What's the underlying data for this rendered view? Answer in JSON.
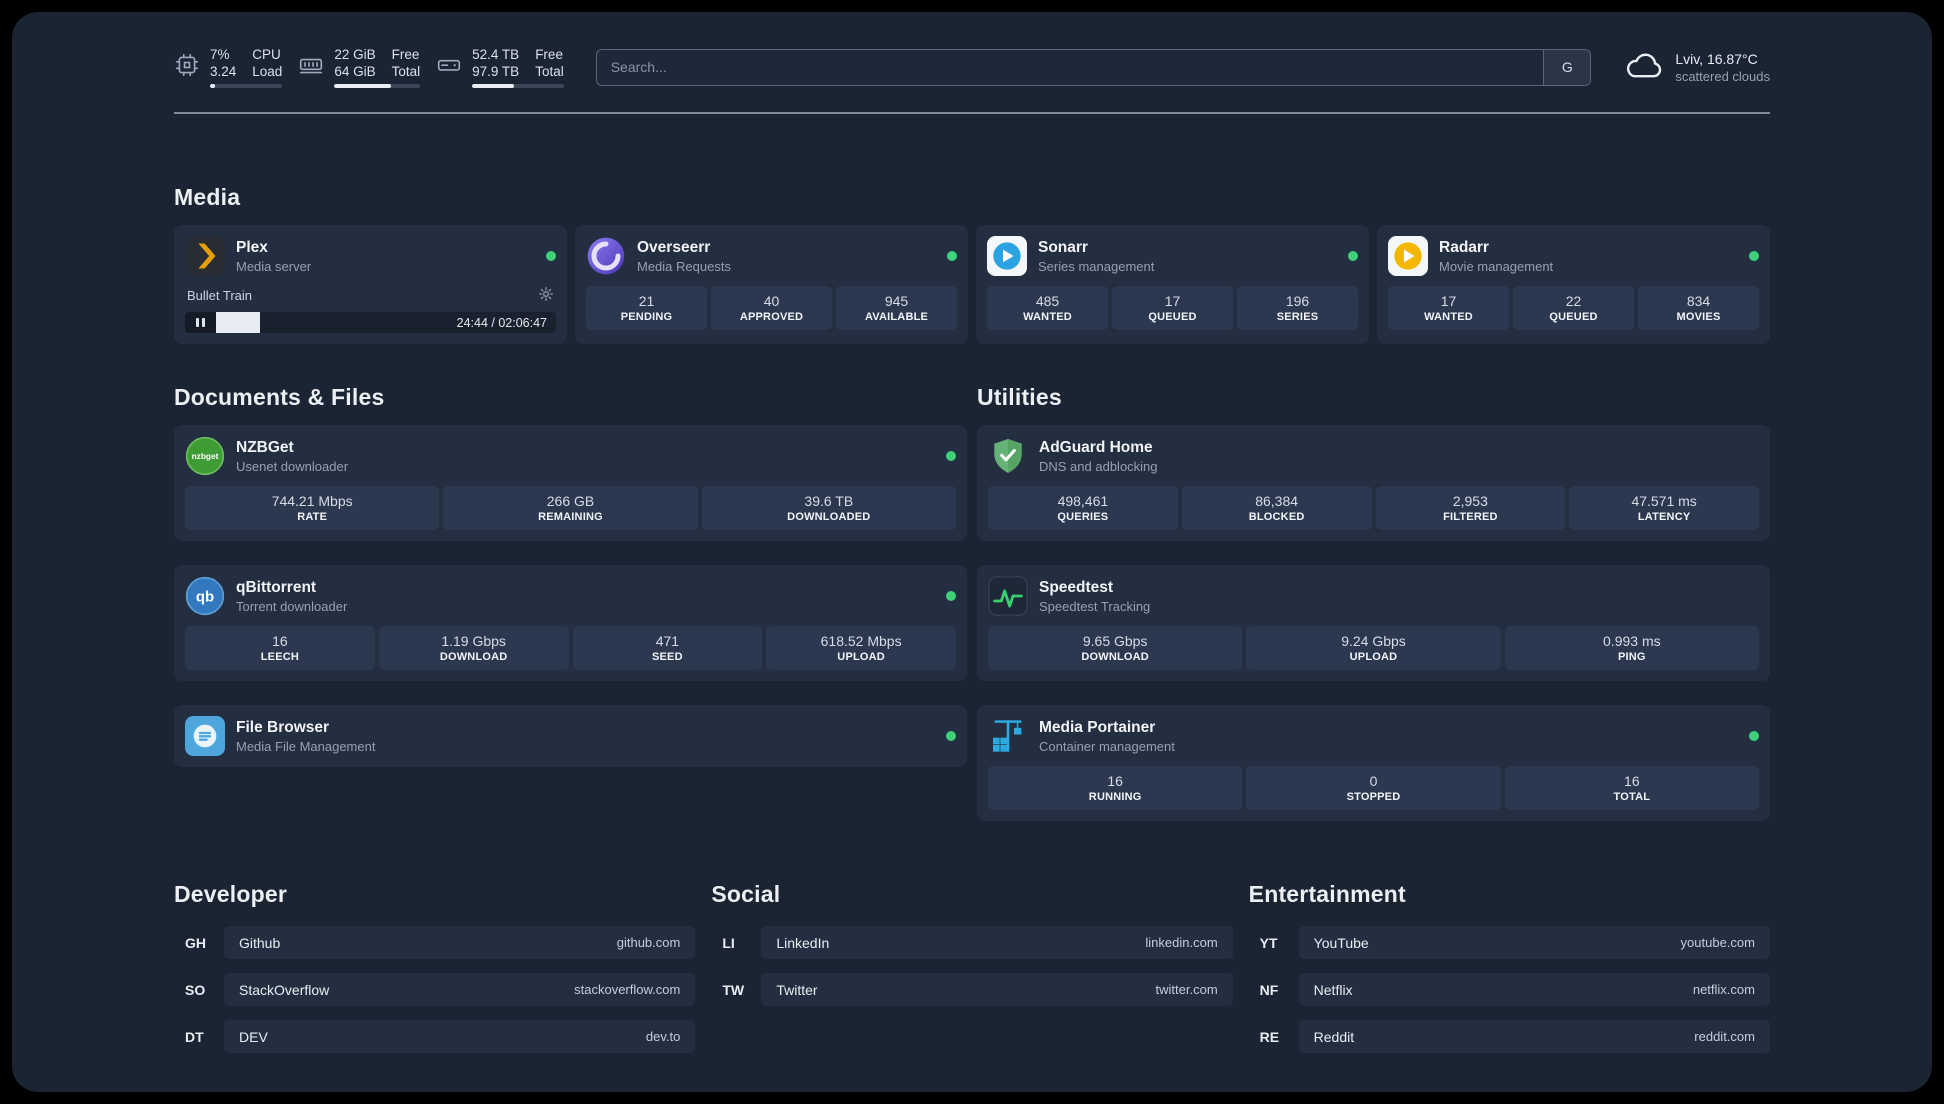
{
  "topbar": {
    "cpu": {
      "icon": "cpu-chip-icon",
      "value_top": "7%",
      "value_bottom": "3.24",
      "label_top": "CPU",
      "label_bottom": "Load",
      "percent": 7
    },
    "ram": {
      "icon": "memory-icon",
      "value_top": "22 GiB",
      "value_bottom": "64 GiB",
      "label_top": "Free",
      "label_bottom": "Total",
      "percent": 66
    },
    "disk": {
      "icon": "hard-drive-icon",
      "value_top": "52.4 TB",
      "value_bottom": "97.9 TB",
      "label_top": "Free",
      "label_bottom": "Total",
      "percent": 46
    },
    "search": {
      "placeholder": "Search...",
      "button_label": "G"
    },
    "weather": {
      "icon": "cloud-icon",
      "location": "Lviv, 16.87°C",
      "condition": "scattered clouds"
    }
  },
  "sections": {
    "media": "Media",
    "documents": "Documents & Files",
    "utilities": "Utilities",
    "developer": "Developer",
    "social": "Social",
    "entertainment": "Entertainment"
  },
  "media": {
    "cards": [
      {
        "name": "Plex",
        "subtitle": "Media server",
        "status": "online",
        "player": {
          "title": "Bullet Train",
          "time": "24:44 / 02:06:47",
          "progress_percent": 13
        }
      },
      {
        "name": "Overseerr",
        "subtitle": "Media Requests",
        "status": "online",
        "stats": [
          {
            "value": "21",
            "label": "PENDING"
          },
          {
            "value": "40",
            "label": "APPROVED"
          },
          {
            "value": "945",
            "label": "AVAILABLE"
          }
        ]
      },
      {
        "name": "Sonarr",
        "subtitle": "Series management",
        "status": "online",
        "stats": [
          {
            "value": "485",
            "label": "WANTED"
          },
          {
            "value": "17",
            "label": "QUEUED"
          },
          {
            "value": "196",
            "label": "SERIES"
          }
        ]
      },
      {
        "name": "Radarr",
        "subtitle": "Movie management",
        "status": "online",
        "stats": [
          {
            "value": "17",
            "label": "WANTED"
          },
          {
            "value": "22",
            "label": "QUEUED"
          },
          {
            "value": "834",
            "label": "MOVIES"
          }
        ]
      }
    ]
  },
  "documents": {
    "cards": [
      {
        "name": "NZBGet",
        "subtitle": "Usenet downloader",
        "status": "online",
        "stats": [
          {
            "value": "744.21 Mbps",
            "label": "RATE"
          },
          {
            "value": "266 GB",
            "label": "REMAINING"
          },
          {
            "value": "39.6 TB",
            "label": "DOWNLOADED"
          }
        ]
      },
      {
        "name": "qBittorrent",
        "subtitle": "Torrent downloader",
        "status": "online",
        "stats": [
          {
            "value": "16",
            "label": "LEECH"
          },
          {
            "value": "1.19 Gbps",
            "label": "DOWNLOAD"
          },
          {
            "value": "471",
            "label": "SEED"
          },
          {
            "value": "618.52 Mbps",
            "label": "UPLOAD"
          }
        ]
      },
      {
        "name": "File Browser",
        "subtitle": "Media File Management",
        "status": "online"
      }
    ]
  },
  "utilities": {
    "cards": [
      {
        "name": "AdGuard Home",
        "subtitle": "DNS and adblocking",
        "stats": [
          {
            "value": "498,461",
            "label": "QUERIES"
          },
          {
            "value": "86,384",
            "label": "BLOCKED"
          },
          {
            "value": "2,953",
            "label": "FILTERED"
          },
          {
            "value": "47.571 ms",
            "label": "LATENCY"
          }
        ]
      },
      {
        "name": "Speedtest",
        "subtitle": "Speedtest Tracking",
        "stats": [
          {
            "value": "9.65 Gbps",
            "label": "DOWNLOAD"
          },
          {
            "value": "9.24 Gbps",
            "label": "UPLOAD"
          },
          {
            "value": "0.993 ms",
            "label": "PING"
          }
        ]
      },
      {
        "name": "Media Portainer",
        "subtitle": "Container management",
        "status": "online",
        "stats": [
          {
            "value": "16",
            "label": "RUNNING"
          },
          {
            "value": "0",
            "label": "STOPPED"
          },
          {
            "value": "16",
            "label": "TOTAL"
          }
        ]
      }
    ]
  },
  "bookmarks": {
    "developer": [
      {
        "abbr": "GH",
        "name": "Github",
        "url": "github.com"
      },
      {
        "abbr": "SO",
        "name": "StackOverflow",
        "url": "stackoverflow.com"
      },
      {
        "abbr": "DT",
        "name": "DEV",
        "url": "dev.to"
      }
    ],
    "social": [
      {
        "abbr": "LI",
        "name": "LinkedIn",
        "url": "linkedin.com"
      },
      {
        "abbr": "TW",
        "name": "Twitter",
        "url": "twitter.com"
      }
    ],
    "entertainment": [
      {
        "abbr": "YT",
        "name": "YouTube",
        "url": "youtube.com"
      },
      {
        "abbr": "NF",
        "name": "Netflix",
        "url": "netflix.com"
      },
      {
        "abbr": "RE",
        "name": "Reddit",
        "url": "reddit.com"
      }
    ]
  },
  "colors": {
    "background": "#1b2433",
    "card": "#232e41",
    "tile": "#2b3850",
    "status_online": "#3fd17a",
    "accent_text": "#edf0f5"
  }
}
